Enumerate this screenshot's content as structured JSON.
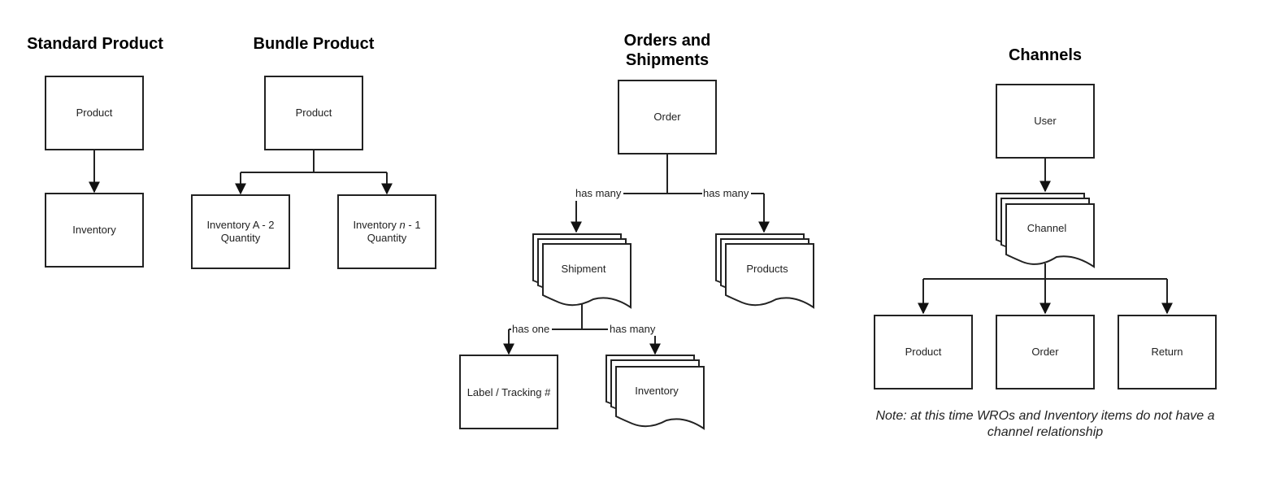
{
  "sections": {
    "standard": {
      "title": "Standard Product",
      "nodes": {
        "product": "Product",
        "inventory": "Inventory"
      }
    },
    "bundle": {
      "title": "Bundle Product",
      "nodes": {
        "product": "Product",
        "inv_a_line1": "Inventory A - 2",
        "inv_a_line2": "Quantity",
        "inv_n_prefix": "Inventory ",
        "inv_n_var": "n",
        "inv_n_suffix": " - 1",
        "inv_n_line2": "Quantity"
      }
    },
    "orders": {
      "title_line1": "Orders and",
      "title_line2": "Shipments",
      "nodes": {
        "order": "Order",
        "shipment": "Shipment",
        "products": "Products",
        "label": "Label / Tracking #",
        "inventory": "Inventory"
      },
      "edges": {
        "order_shipment": "has many",
        "order_products": "has many",
        "shipment_label": "has one",
        "shipment_inventory": "has many"
      }
    },
    "channels": {
      "title": "Channels",
      "nodes": {
        "user": "User",
        "channel": "Channel",
        "product": "Product",
        "order": "Order",
        "return": "Return"
      },
      "note_line1": "Note: at this time WROs and Inventory items do not have a",
      "note_line2": "channel relationship"
    }
  }
}
